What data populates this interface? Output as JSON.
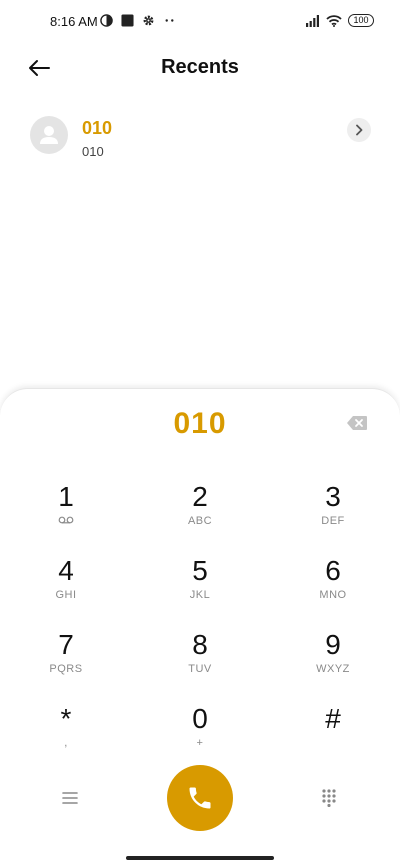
{
  "status_bar": {
    "time": "8:16 AM",
    "left_icons": [
      "pie-status-icon",
      "square-status-icon",
      "settings-gear-icon",
      "more-dots-icon"
    ],
    "right_icons": [
      "signal-icon",
      "wifi-icon"
    ],
    "battery": "100"
  },
  "header": {
    "title": "Recents",
    "back_icon": "arrow-left-icon"
  },
  "recents": [
    {
      "name": "010",
      "number": "010"
    }
  ],
  "dialer": {
    "display": "010",
    "keys": [
      {
        "digit": "1",
        "letters": ""
      },
      {
        "digit": "2",
        "letters": "ABC"
      },
      {
        "digit": "3",
        "letters": "DEF"
      },
      {
        "digit": "4",
        "letters": "GHI"
      },
      {
        "digit": "5",
        "letters": "JKL"
      },
      {
        "digit": "6",
        "letters": "MNO"
      },
      {
        "digit": "7",
        "letters": "PQRS"
      },
      {
        "digit": "8",
        "letters": "TUV"
      },
      {
        "digit": "9",
        "letters": "WXYZ"
      },
      {
        "digit": "*",
        "letters": ","
      },
      {
        "digit": "0",
        "letters": "+"
      },
      {
        "digit": "#",
        "letters": ""
      }
    ]
  },
  "colors": {
    "accent": "#d89a00",
    "text": "#111111",
    "subtext": "#8a8a8a"
  }
}
